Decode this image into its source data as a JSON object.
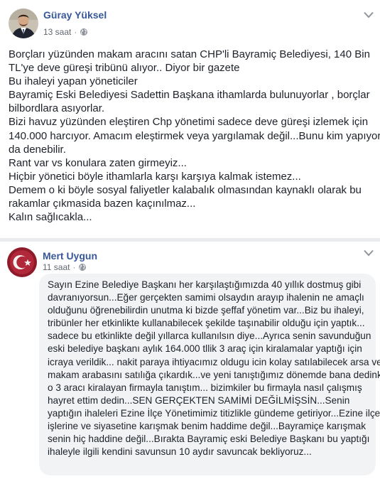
{
  "post1": {
    "author": "Güray Yüksel",
    "time": "13 saat",
    "separator": "·",
    "privacy_icon": "globe-icon",
    "more_icon": "chevron-down-icon",
    "lines": [
      "Borçları yüzünden makam aracını satan CHP'li Bayramiç Belediyesi, 140 Bin",
      "TL'ye deve güreşi tribünü alıyor.. Diyor bir gazete",
      "Bu ihaleyi yapan yöneticiler",
      "Bayramiç Eski Belediyesi Sadettin Başkana ithamlarda bulunuyorlar , borçlar",
      "bilbordlara asıyorlar.",
      "Bizi havuz yüzünden eleştiren Chp yönetimi sadece deve güreşi izlemek için",
      "140.000 harcıyor. Amacım eleştirmek veya yargılamak değil...Bunu kim yapıyor",
      "da denebilir.",
      "Rant var vs konulara zaten girmeyiz...",
      "Hiçbir yönetici böyle ithamlarla karşı karşıya kalmak istemez...",
      "Demem o ki böyle sosyal faliyetler kalabalık olmasından kaynaklı olarak bu",
      "rakamlar çıkmasida bazen kaçınılmaz...",
      "Kalın sağlıcakla..."
    ]
  },
  "post2": {
    "author": "Mert Uygun",
    "time": "11 saat",
    "separator": "·",
    "privacy_icon": "globe-icon",
    "more_icon": "chevron-down-icon",
    "lines": [
      "Sayın Ezine Belediye Başkanı her karşılaştığımızda 40 yıllık dostmuş gibi",
      "davranıyorsun...Eğer gerçekten samimi olsaydın arayıp ihalenin ne amaçlı",
      "olduğunu öğrenebilirdin unutma ki bizde şeffaf yönetim var...Biz bu ihaleyi,",
      "tribünler her etkinlikte kullanabilecek şekilde taşınabilir olduğu için yaptık...",
      "sadece bu etkinlikte değil yıllarca kullanılsın diye...Ayrıca senin savunduğun",
      "eski belediye başkanı aylık 164.000 tllik 3 araç için kiralamalar yaptığı için",
      "icraya verildik... nakit paraya ihtiyacımız oldugu icin kolay satılabilecek arsa ve",
      "makam arabasını satılığa çıkardık...ve yeni tanıştığımız dönemde bana dedinki",
      "o 3 aracı kiralayan firmayla tanıştım... bizimkiler bu firmayla nasıl çalışmış",
      "hayret ettim dedin...SEN GERÇEKTEN SAMİMİ DEĞİLMİŞSİN...Senin",
      "yaptığın ihaleleri Ezine İlçe Yönetimimiz titizlikle gündeme getiriyor...Ezine ilçe",
      "işlerine ve siyasetine karışmak benim haddime değil...Bayramiçe karışmak",
      "senin hiç haddine değil...Bırakta Bayramiç eski Belediye Başkanı bu yaptığı",
      "ihaleyle ilgili kendini savunsun 10 aydır savuncak bekliyoruz..."
    ]
  },
  "colors": {
    "author_link": "#365899",
    "body_text": "#1d2129",
    "meta_text": "#616770",
    "comment_bubble": "#f2f3f5",
    "page_background": "#e9ebee",
    "card_background": "#ffffff"
  }
}
